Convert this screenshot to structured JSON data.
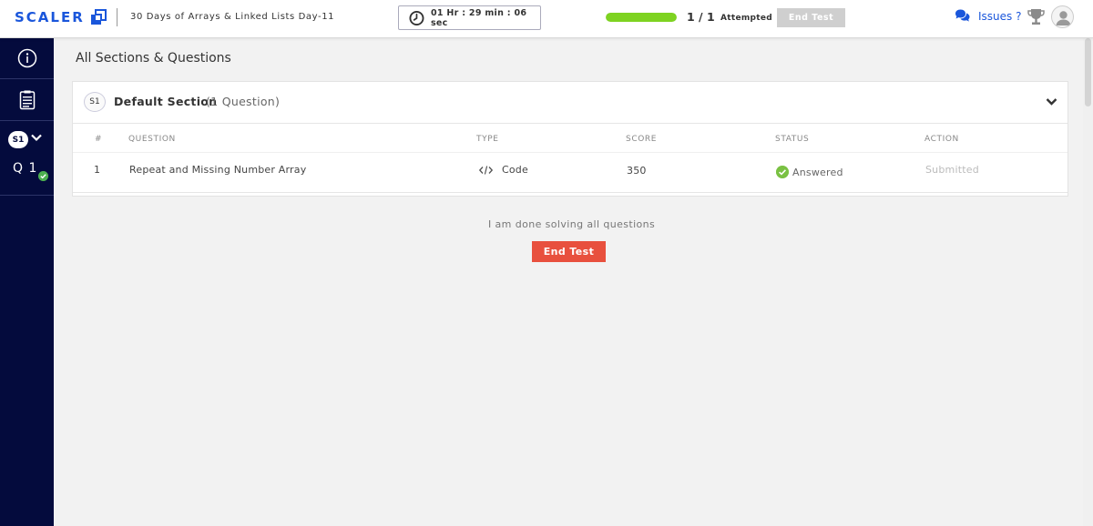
{
  "header": {
    "logo_text": "SCALER",
    "test_title": "30 Days of Arrays & Linked Lists Day-11",
    "timer": "01 Hr : 29 min : 06 sec",
    "progress_fraction": 1.0,
    "attempt_count": "1 / 1",
    "attempt_label": "Attempted",
    "end_test_label": "End Test",
    "issues_label": "Issues ?",
    "icons": [
      "scaler-logo-icon",
      "clock-icon",
      "chat-icon",
      "trophy-icon",
      "user-avatar-icon"
    ]
  },
  "sidebar": {
    "icons": [
      "info-icon",
      "question-list-icon",
      "chevron-down-icon",
      "check-circle-icon"
    ],
    "section_badge": "S1",
    "question_label": "Q 1"
  },
  "main": {
    "heading": "All Sections & Questions",
    "section": {
      "badge": "S1",
      "name": "Default Section",
      "count": "(1 Question)",
      "columns": [
        "#",
        "QUESTION",
        "TYPE",
        "SCORE",
        "STATUS",
        "ACTION"
      ],
      "rows": [
        {
          "index": "1",
          "question": "Repeat and Missing Number Array",
          "type": "Code",
          "score": "350",
          "status": "Answered",
          "action": "Submitted"
        }
      ]
    },
    "done_text": "I am done solving all questions",
    "end_test_label": "End Test"
  },
  "colors": {
    "brand": "#1a56db",
    "sidebar_bg": "#040b3d",
    "progress": "#7ed321",
    "answered": "#7ac143",
    "end_test": "#e8503e",
    "disabled": "#cfcfcf"
  }
}
